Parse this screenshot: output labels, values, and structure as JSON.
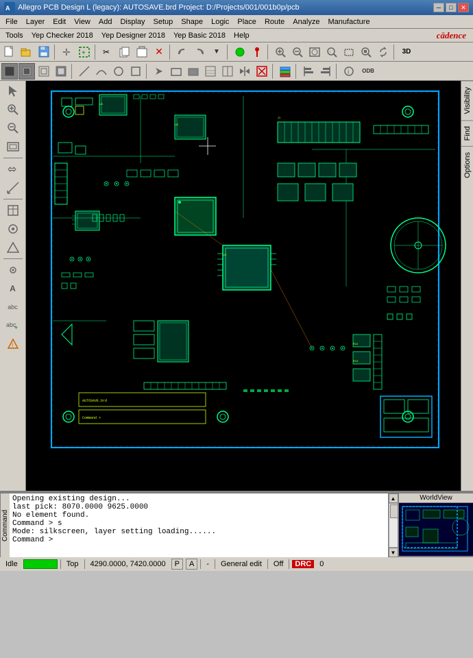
{
  "titleBar": {
    "title": "Allegro PCB Design L (legacy): AUTOSAVE.brd  Project: D:/Projects/001/001b0p/pcb",
    "icon": "pcb-icon",
    "winControls": {
      "minimize": "─",
      "maximize": "□",
      "close": "✕"
    }
  },
  "menuBar1": {
    "items": [
      "File",
      "Layer",
      "Edit",
      "View",
      "Add",
      "Display",
      "Setup",
      "Shape",
      "Logic",
      "Place",
      "Route",
      "Analyze",
      "Manufacture"
    ]
  },
  "menuBar2": {
    "items": [
      "Tools",
      "Yep Checker 2018",
      "Yep Designer 2018",
      "Yep Basic 2018",
      "Help"
    ],
    "logo": "cādence"
  },
  "toolbar1": {
    "buttons": [
      {
        "name": "new-btn",
        "icon": "📄",
        "label": "New"
      },
      {
        "name": "open-btn",
        "icon": "📂",
        "label": "Open"
      },
      {
        "name": "save-btn",
        "icon": "💾",
        "label": "Save"
      },
      {
        "name": "sep1",
        "type": "separator"
      },
      {
        "name": "select-btn",
        "icon": "✛",
        "label": "Select"
      },
      {
        "name": "sep2",
        "type": "separator"
      },
      {
        "name": "cut-btn",
        "icon": "✂",
        "label": "Cut"
      },
      {
        "name": "copy-btn",
        "icon": "⧉",
        "label": "Copy"
      },
      {
        "name": "paste-btn",
        "icon": "📋",
        "label": "Paste"
      },
      {
        "name": "delete-btn",
        "icon": "✕",
        "label": "Delete"
      },
      {
        "name": "sep3",
        "type": "separator"
      },
      {
        "name": "undo-btn",
        "icon": "↩",
        "label": "Undo"
      },
      {
        "name": "redo-btn",
        "icon": "↪",
        "label": "Redo"
      },
      {
        "name": "sep4",
        "type": "separator"
      },
      {
        "name": "zoom-in-btn",
        "icon": "◉",
        "label": "Zoom In"
      },
      {
        "name": "zoom-out-btn",
        "icon": "⊕",
        "label": "Zoom Out"
      },
      {
        "name": "zoom-fit-btn",
        "icon": "⊞",
        "label": "Zoom Fit"
      },
      {
        "name": "zoom-prev-btn",
        "icon": "⊟",
        "label": "Zoom Prev"
      },
      {
        "name": "sep5",
        "type": "separator"
      },
      {
        "name": "zoom-world-btn",
        "icon": "🔍",
        "label": "Zoom World"
      },
      {
        "name": "refresh-btn",
        "icon": "↻",
        "label": "Refresh"
      },
      {
        "name": "sep6",
        "type": "separator"
      },
      {
        "name": "3d-btn",
        "icon": "3D",
        "label": "3D View"
      }
    ]
  },
  "toolbar2": {
    "buttons": [
      {
        "name": "t2-btn1",
        "icon": "▣"
      },
      {
        "name": "t2-btn2",
        "icon": "▪"
      },
      {
        "name": "t2-btn3",
        "icon": "⬚"
      },
      {
        "name": "t2-btn4",
        "icon": "▩"
      },
      {
        "name": "t2-sep1",
        "type": "separator"
      },
      {
        "name": "t2-btn5",
        "icon": "▬"
      },
      {
        "name": "t2-btn6",
        "icon": "╱"
      },
      {
        "name": "t2-btn7",
        "icon": "○"
      },
      {
        "name": "t2-btn8",
        "icon": "◻"
      },
      {
        "name": "t2-sep2",
        "type": "separator"
      },
      {
        "name": "t2-btn9",
        "icon": "▷"
      },
      {
        "name": "t2-btn10",
        "icon": "⬜"
      },
      {
        "name": "t2-btn11",
        "icon": "⬛"
      },
      {
        "name": "t2-btn12",
        "icon": "▣"
      },
      {
        "name": "t2-btn13",
        "icon": "⬚"
      },
      {
        "name": "t2-btn14",
        "icon": "↕"
      },
      {
        "name": "t2-btn15",
        "icon": "⊠"
      },
      {
        "name": "t2-sep3",
        "type": "separator"
      },
      {
        "name": "t2-btn16",
        "icon": "⊟"
      },
      {
        "name": "t2-sep4",
        "type": "separator"
      },
      {
        "name": "t2-btn17",
        "icon": "◧"
      },
      {
        "name": "t2-btn18",
        "icon": "◨"
      },
      {
        "name": "t2-sep5",
        "type": "separator"
      },
      {
        "name": "t2-btn19",
        "icon": "⬛"
      },
      {
        "name": "t2-btn20",
        "icon": "ODB"
      }
    ]
  },
  "leftPanel": {
    "buttons": [
      {
        "name": "lp-select",
        "icon": "↖"
      },
      {
        "name": "lp-zoom-in",
        "icon": "⊕"
      },
      {
        "name": "lp-zoom-out",
        "icon": "⊖"
      },
      {
        "name": "lp-zoom-fit",
        "icon": "⊞"
      },
      {
        "name": "sep1",
        "type": "separator"
      },
      {
        "name": "lp-add-connect",
        "icon": "⬄"
      },
      {
        "name": "lp-add-line",
        "icon": "╱"
      },
      {
        "name": "sep2",
        "type": "separator"
      },
      {
        "name": "lp-component",
        "icon": "⊡"
      },
      {
        "name": "lp-via",
        "icon": "◎"
      },
      {
        "name": "lp-shape",
        "icon": "△"
      },
      {
        "name": "sep3",
        "type": "separator"
      },
      {
        "name": "lp-property",
        "icon": "⚙"
      },
      {
        "name": "lp-text",
        "icon": "A"
      },
      {
        "name": "lp-text2",
        "icon": "abc"
      },
      {
        "name": "lp-drc",
        "icon": "⚠"
      }
    ]
  },
  "rightPanel": {
    "tabs": [
      "Visibility",
      "Find",
      "Options"
    ]
  },
  "console": {
    "label": "Command",
    "lines": [
      "Opening existing design...",
      "last pick:  8070.0000 9625.0000",
      "No element found.",
      "Command > s",
      "Mode: silkscreen, layer setting loading......",
      "Command >"
    ]
  },
  "statusBar": {
    "idleText": "Idle",
    "statusGreen": "",
    "layer": "Top",
    "coordinates": "4290.0000, 7420.0000",
    "pickMode": "P",
    "snapMode": "A",
    "separator1": "|",
    "separator2": "·",
    "editMode": "General edit",
    "offLabel": "Off",
    "drcStatus": "DRC",
    "counter": "0"
  },
  "minimap": {
    "label": "WorldView"
  },
  "pcbBoard": {
    "outlineColor": "#00aaff",
    "traceColor": "#00ff88",
    "silkColor": "#ccff00",
    "viaColor": "#00ff88"
  }
}
